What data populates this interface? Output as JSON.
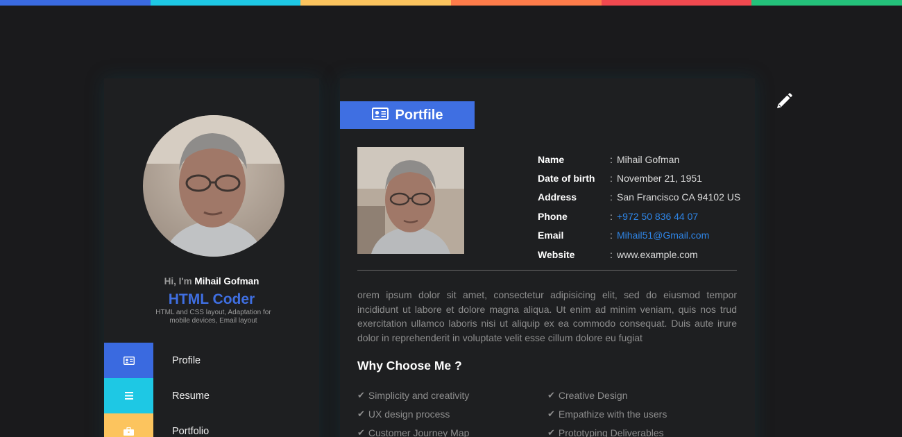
{
  "topbar": {
    "colors": [
      "#3a6ae0",
      "#1ec8e4",
      "#fcc45e",
      "#fe7c4a",
      "#f0494f",
      "#24c17a"
    ]
  },
  "edit_icon": "pencil-icon",
  "sidebar": {
    "greeting_prefix": "Hi, I'm",
    "name": "Mihail Gofman",
    "role": "HTML Coder",
    "role_description": "HTML and CSS layout, Adaptation for mobile devices, Email layout",
    "menu": [
      {
        "label": "Profile",
        "icon": "id-card-icon",
        "color": "#3a6ae0"
      },
      {
        "label": "Resume",
        "icon": "list-icon",
        "color": "#1ec8e4"
      },
      {
        "label": "Portfolio",
        "icon": "briefcase-icon",
        "color": "#fcc45e"
      }
    ]
  },
  "main": {
    "section_title": "Portfile",
    "section_icon": "id-card-icon",
    "info": [
      {
        "key": "Name",
        "value": "Mihail Gofman"
      },
      {
        "key": "Date of birth",
        "value": "November 21, 1951"
      },
      {
        "key": "Address",
        "value": "San Francisco CA 94102 US"
      },
      {
        "key": "Phone",
        "value": "+972 50 836 44 07"
      },
      {
        "key": "Email",
        "value": "Mihail51@Gmail.com"
      },
      {
        "key": "Website",
        "value": "www.example.com"
      }
    ],
    "about": "orem ipsum dolor sit amet, consectetur adipisicing elit, sed do eiusmod tempor incididunt ut labore et dolore magna aliqua. Ut enim ad minim veniam, quis nos trud exercitation ullamco laboris nisi ut aliquip ex ea commodo consequat. Duis aute irure dolor in reprehenderit in voluptate velit esse cillum dolore eu fugiat",
    "why_title": "Why Choose Me ?",
    "features": [
      "Simplicity and creativity",
      "Creative Design",
      "UX design process",
      "Empathize with the users",
      "Customer Journey Map",
      "Prototyping Deliverables"
    ],
    "accent": "#3f6fe2",
    "link_color": "#2f86e8"
  }
}
